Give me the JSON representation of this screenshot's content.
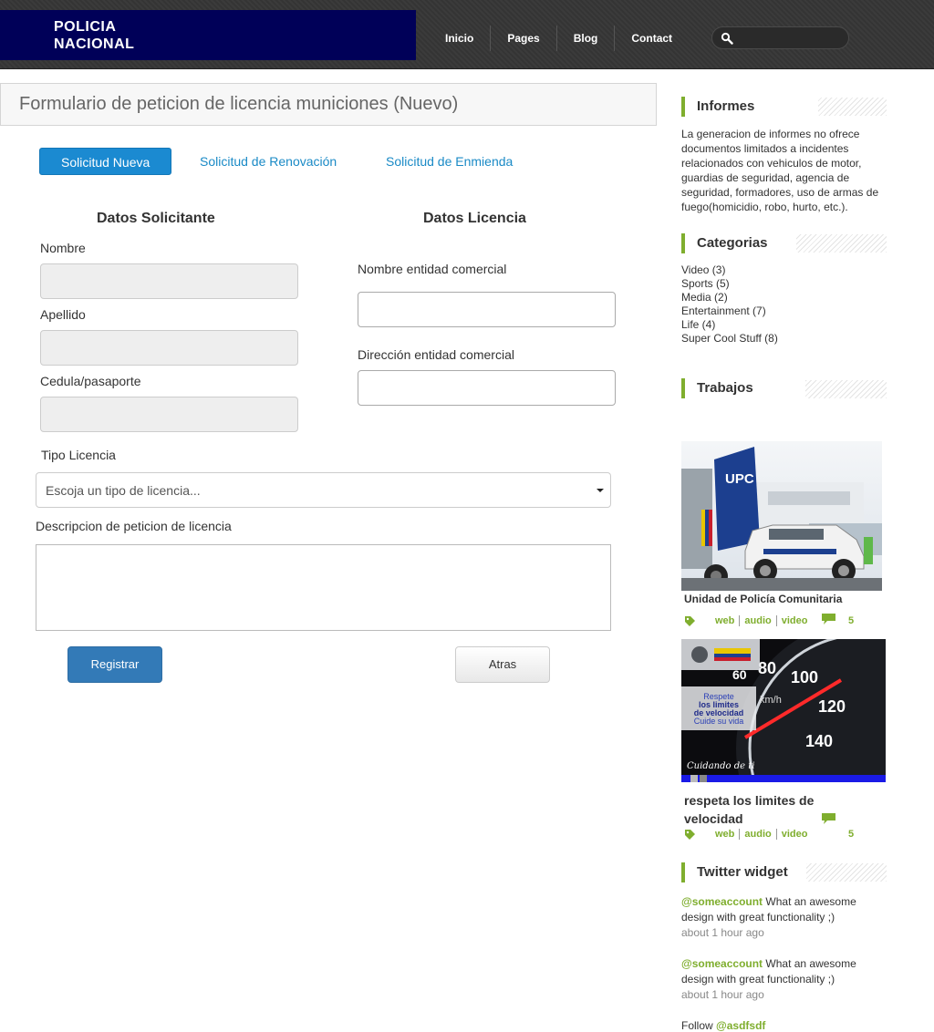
{
  "header": {
    "logo_line1": "POLICIA",
    "logo_line2": "NACIONAL",
    "nav": [
      "Inicio",
      "Pages",
      "Blog",
      "Contact"
    ],
    "search_placeholder": ""
  },
  "form": {
    "title": "Formulario de peticion de licencia municiones (Nuevo)",
    "tabs": [
      "Solicitud Nueva",
      "Solicitud de Renovación",
      "Solicitud de Enmienda"
    ],
    "applicant_heading": "Datos Solicitante",
    "license_heading": "Datos Licencia",
    "labels": {
      "nombre": "Nombre",
      "apellido": "Apellido",
      "cedula": "Cedula/pasaporte",
      "entidad": "Nombre entidad comercial",
      "direccion": "Dirección entidad comercial",
      "tipo": "Tipo Licencia",
      "descripcion": "Descripcion de peticion de licencia"
    },
    "tipo_placeholder": "Escoja un tipo de licencia...",
    "submit": "Registrar",
    "back": "Atras"
  },
  "sidebar": {
    "informes_title": "Informes",
    "informes_text": "La generacion de informes no ofrece documentos limitados a incidentes relacionados con vehiculos de motor, guardias de seguridad, agencia de seguridad, formadores, uso de armas de fuego(homicidio, robo, hurto, etc.).",
    "categorias_title": "Categorias",
    "categorias": [
      "Video (3)",
      "Sports (5)",
      "Media (2)",
      "Entertainment (7)",
      "Life (4)",
      "Super Cool Stuff (8)"
    ],
    "trabajos_title": "Trabajos",
    "works": [
      {
        "title": "Unidad de Policía Comunitaria",
        "tags": [
          "web",
          "audio",
          "video"
        ],
        "comments": "5",
        "image_text": "UPC"
      },
      {
        "title": "respeta los limites de velocidad",
        "tags": [
          "web",
          "audio",
          "video"
        ],
        "comments": "5",
        "image_lines": [
          "Respete",
          "los limites",
          "de velocidad",
          "Cuide su vida"
        ],
        "image_caption": "Cuidando de ti"
      }
    ],
    "twitter_title": "Twitter widget",
    "tweets": [
      {
        "account": "@someaccount",
        "text": " What an awesome design with great functionality ;)",
        "time": "about 1 hour ago"
      },
      {
        "account": "@someaccount",
        "text": " What an awesome design with great functionality ;)",
        "time": "about 1 hour ago"
      }
    ],
    "follow_prefix": "Follow ",
    "follow_account": "@asdfsdf"
  },
  "colors": {
    "logo_bg": "#000058",
    "accent_green": "#7fae2e",
    "tab_blue": "#1b8ad1",
    "primary_button": "#337ab7"
  }
}
